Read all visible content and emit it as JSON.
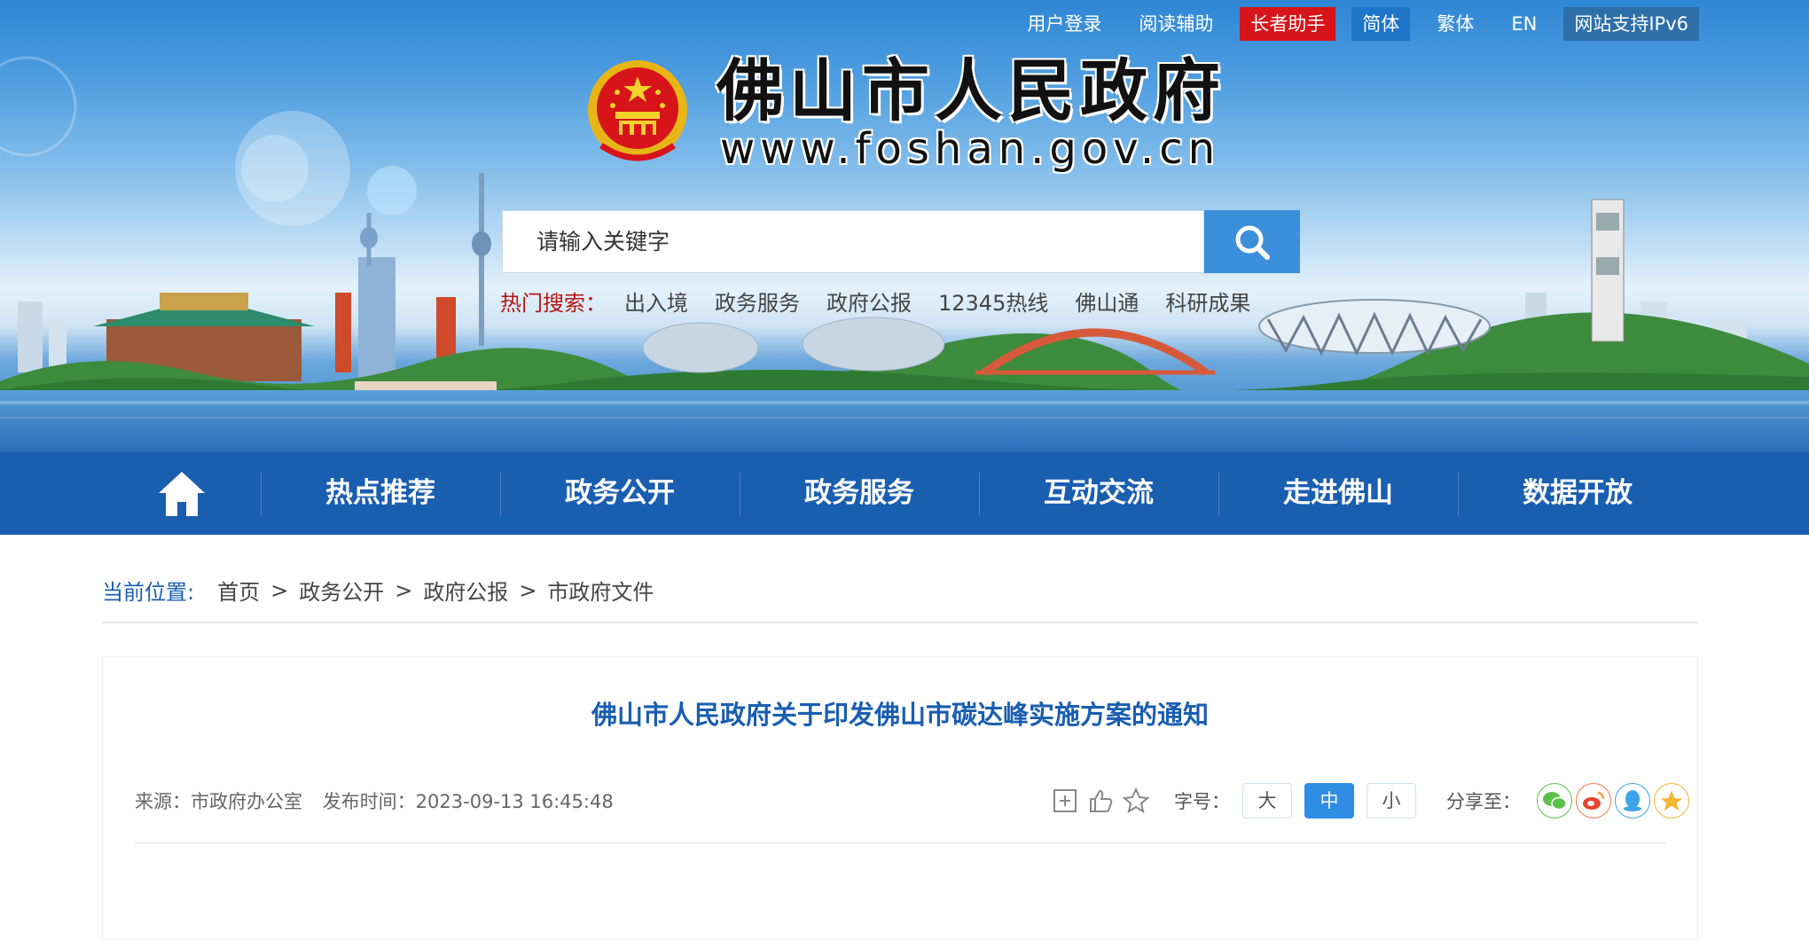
{
  "top_links": {
    "login": "用户登录",
    "reading_aid": "阅读辅助",
    "elder": "长者助手",
    "simplified": "简体",
    "traditional": "繁体",
    "english": "EN",
    "ipv6": "网站支持IPv6"
  },
  "header": {
    "site_title": "佛山市人民政府",
    "site_url": "www.foshan.gov.cn",
    "emblem_icon": "national-emblem-icon"
  },
  "search": {
    "placeholder": "请输入关键字",
    "button_icon": "search-icon",
    "hot_label": "热门搜索：",
    "hot_items": [
      "出入境",
      "政务服务",
      "政府公报",
      "12345热线",
      "佛山通",
      "科研成果"
    ]
  },
  "nav": {
    "home_icon": "home-icon",
    "items": [
      "热点推荐",
      "政务公开",
      "政务服务",
      "互动交流",
      "走进佛山",
      "数据开放"
    ]
  },
  "breadcrumb": {
    "label": "当前位置:",
    "items": [
      "首页",
      "政务公开",
      "政府公报",
      "市政府文件"
    ],
    "separator": ">"
  },
  "article": {
    "title": "佛山市人民政府关于印发佛山市碳达峰实施方案的通知",
    "source": "来源：市政府办公室",
    "publish_time": "发布时间：2023-09-13 16:45:48",
    "font_label": "字号：",
    "font_sizes": [
      "大",
      "中",
      "小"
    ],
    "font_selected": "中",
    "share_label": "分享至：",
    "share_targets": [
      "wechat-icon",
      "weibo-icon",
      "qq-icon",
      "qzone-icon"
    ]
  },
  "colors": {
    "nav_bg": "#1a5eb0",
    "accent": "#2f8de4",
    "elder_bg": "#d7141a",
    "title_blue": "#1a5eb0"
  }
}
